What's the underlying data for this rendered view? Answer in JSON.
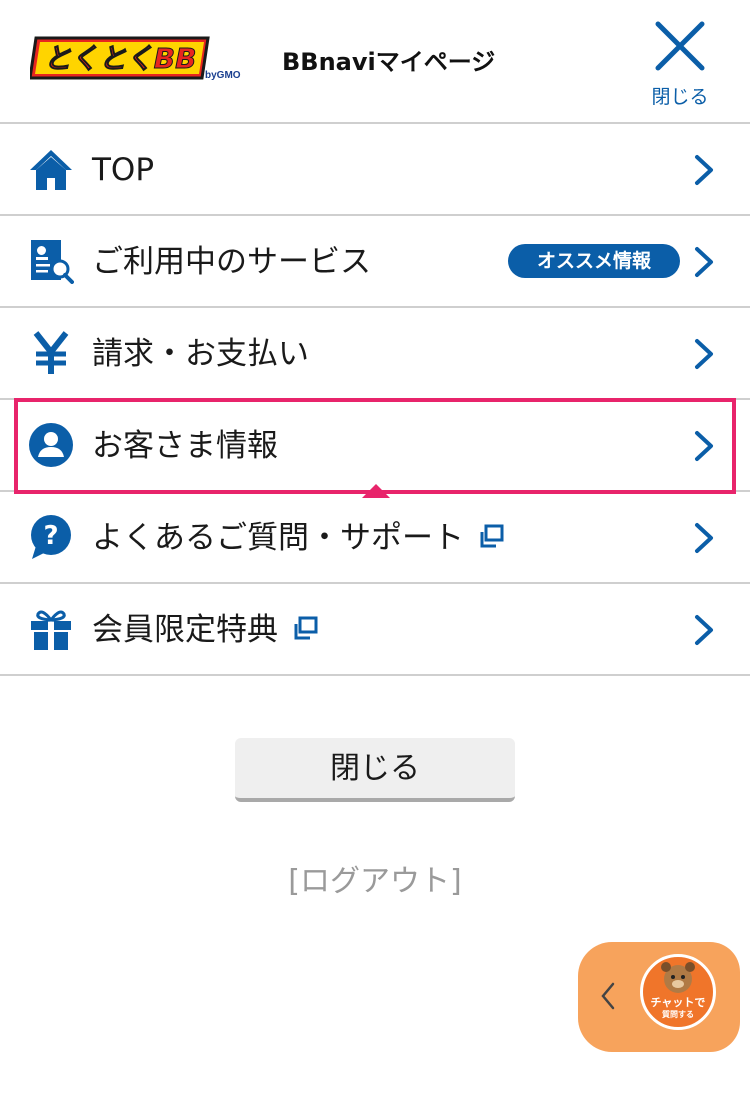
{
  "header": {
    "logo_text": "とくとくBB",
    "logo_by": "byGMO",
    "title": "BBnaviマイページ",
    "close_label": "閉じる"
  },
  "menu": {
    "items": [
      {
        "label": "TOP",
        "icon": "home-icon"
      },
      {
        "label": "ご利用中のサービス",
        "icon": "service-search-icon",
        "badge": "オススメ情報"
      },
      {
        "label": "請求・お支払い",
        "icon": "yen-icon"
      },
      {
        "label": "お客さま情報",
        "icon": "user-icon",
        "highlighted": true
      },
      {
        "label": "よくあるご質問・サポート",
        "icon": "question-icon",
        "external": true
      },
      {
        "label": "会員限定特典",
        "icon": "gift-icon",
        "external": true
      }
    ]
  },
  "footer": {
    "close_button": "閉じる",
    "logout": "[ログアウト]"
  },
  "chat": {
    "line1": "チャットで",
    "line2": "質問する"
  },
  "colors": {
    "accent": "#0b5ea8",
    "highlight": "#e8246b",
    "chat": "#f7a35c"
  }
}
